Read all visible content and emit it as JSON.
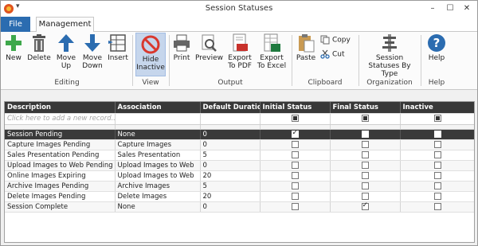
{
  "window": {
    "title": "Session Statuses",
    "minimize": "–",
    "maximize": "☐",
    "close": "✕",
    "qa_arrow": "▾"
  },
  "tabs": {
    "file": "File",
    "management": "Management"
  },
  "ribbon": {
    "new": "New",
    "delete": "Delete",
    "move_up": "Move Up",
    "move_down": "Move Down",
    "insert": "Insert",
    "hide_inactive": "Hide Inactive",
    "print": "Print",
    "preview": "Preview",
    "export_pdf": "Export To PDF",
    "export_excel": "Export To Excel",
    "paste": "Paste",
    "copy": "Copy",
    "cut": "Cut",
    "session_statuses_by_type": "Session Statuses By Type",
    "help": "Help",
    "groups": {
      "editing": "Editing",
      "view": "View",
      "output": "Output",
      "clipboard": "Clipboard",
      "organization": "Organization",
      "help": "Help"
    }
  },
  "grid": {
    "columns": [
      "Description",
      "Association",
      "Default Duration",
      "Initial Status",
      "Final Status",
      "Inactive"
    ],
    "new_row_placeholder": "Click here to add a new record...",
    "rows": [
      {
        "description": "Session Pending",
        "association": "None",
        "duration": "0",
        "initial": true,
        "final": false,
        "inactive": false,
        "selected": true
      },
      {
        "description": "Capture Images Pending",
        "association": "Capture Images",
        "duration": "0",
        "initial": false,
        "final": false,
        "inactive": false
      },
      {
        "description": "Sales Presentation Pending",
        "association": "Sales Presentation",
        "duration": "5",
        "initial": false,
        "final": false,
        "inactive": false
      },
      {
        "description": "Upload Images to Web Pending",
        "association": "Upload Images to Web",
        "duration": "0",
        "initial": false,
        "final": false,
        "inactive": false
      },
      {
        "description": "Online Images Expiring",
        "association": "Upload Images to Web",
        "duration": "20",
        "initial": false,
        "final": false,
        "inactive": false
      },
      {
        "description": "Archive Images Pending",
        "association": "Archive Images",
        "duration": "5",
        "initial": false,
        "final": false,
        "inactive": false
      },
      {
        "description": "Delete Images Pending",
        "association": "Delete Images",
        "duration": "20",
        "initial": false,
        "final": false,
        "inactive": false
      },
      {
        "description": "Session Complete",
        "association": "None",
        "duration": "0",
        "initial": false,
        "final": true,
        "inactive": false
      }
    ]
  },
  "colors": {
    "accent": "#2b6cb0",
    "selected_row": "#3a3a3a",
    "header": "#383838",
    "active_button": "#c6d6ec"
  }
}
